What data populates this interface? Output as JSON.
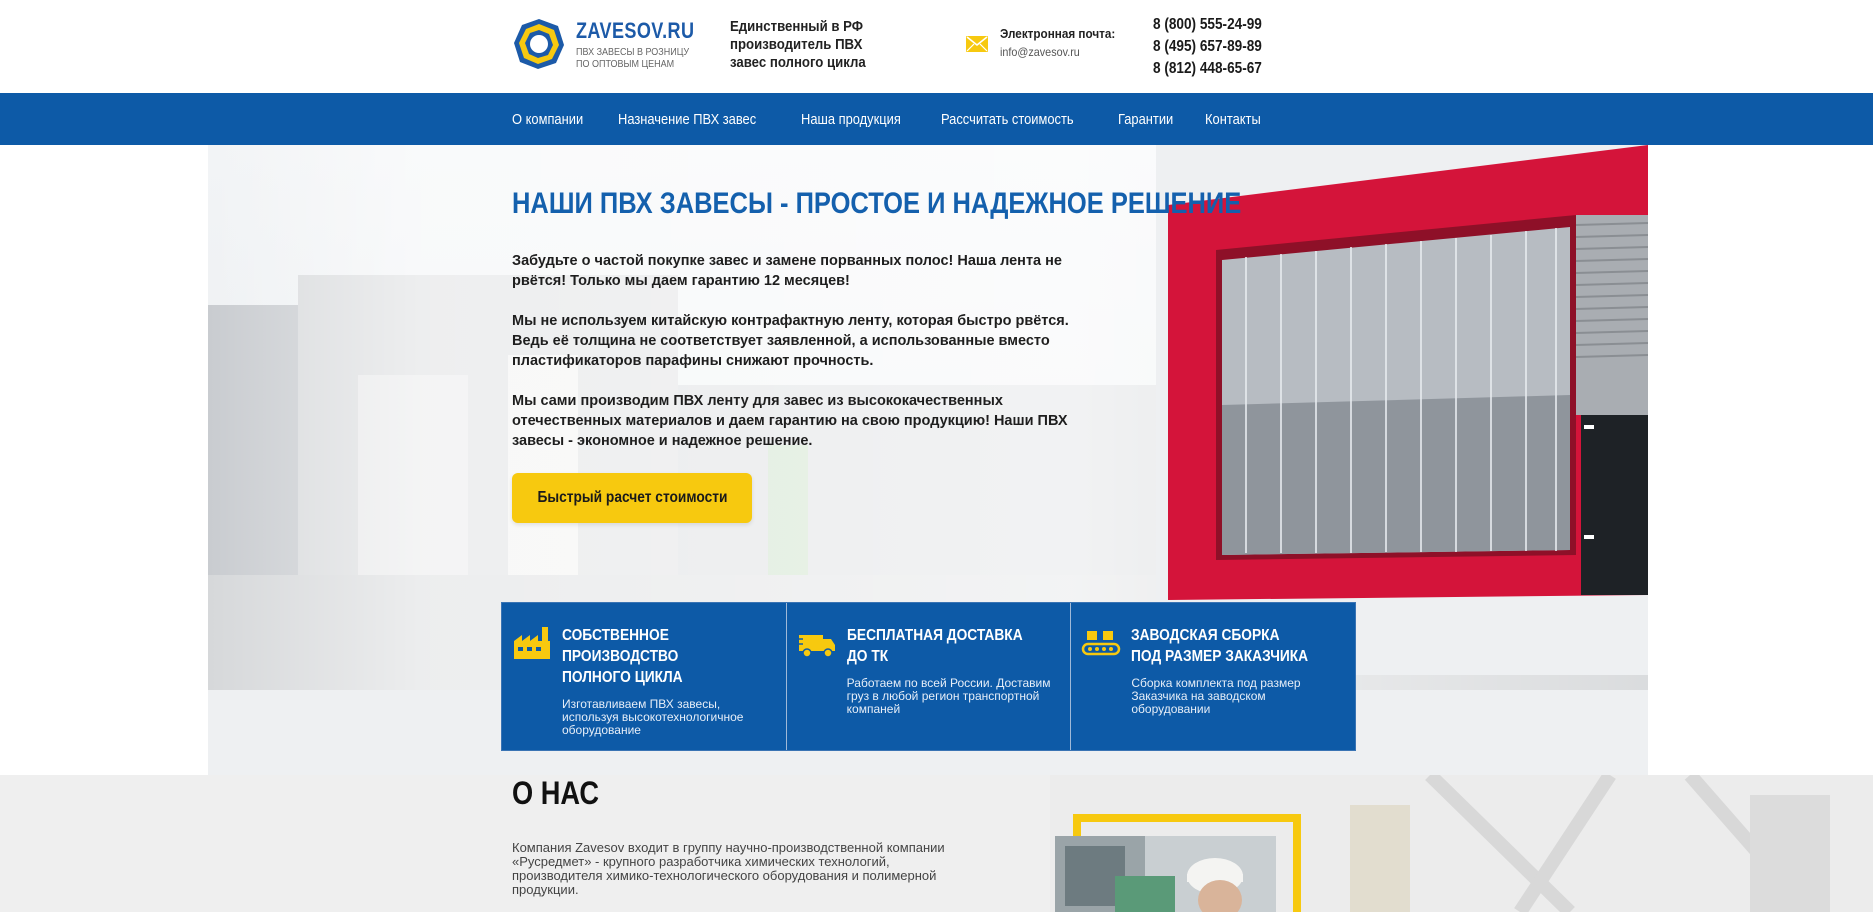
{
  "header": {
    "logo_name": "ZAVESOV.RU",
    "logo_tag_line1": "ПВХ ЗАВЕСЫ В РОЗНИЦУ",
    "logo_tag_line2": "ПО ОПТОВЫМ ЦЕНАМ",
    "slogan": "Единственный в РФ производитель ПВХ завес полного цикла",
    "email_label": "Электронная почта:",
    "email": "info@zavesov.ru",
    "phones": [
      "8 (800) 555-24-99",
      "8 (495) 657-89-89",
      "8 (812) 448-65-67"
    ]
  },
  "nav": {
    "items": [
      "О компании",
      "Назначение ПВХ завес",
      "Наша продукция",
      "Рассчитать стоимость",
      "Гарантии",
      "Контакты"
    ]
  },
  "hero": {
    "title": "НАШИ ПВХ ЗАВЕСЫ - ПРОСТОЕ И НАДЕЖНОЕ РЕШЕНИЕ",
    "p1": "Забудьте о частой покупке завес и замене порванных полос! Наша лента не рвётся! Только мы даем гарантию 12 месяцев!",
    "p2": "Мы не используем китайскую контрафактную ленту, которая быстро рвётся. Ведь её толщина не соответствует заявленной, а использованные вместо пластификаторов парафины снижают прочность.",
    "p3": "Мы сами производим ПВХ ленту для завес из высококачественных отечественных материалов и даем гарантию на свою продукцию! Наши ПВХ завесы - экономное и надежное решение.",
    "cta": "Быстрый расчет стоимости"
  },
  "features": [
    {
      "title": "Собственное производство полного цикла",
      "text": "Изготавливаем ПВХ завесы, используя высокотехнологичное оборудование",
      "icon": "factory-icon"
    },
    {
      "title": "Бесплатная доставка до ТК",
      "text": "Работаем по всей России. Доставим груз в любой регион транспортной компаней",
      "icon": "truck-icon"
    },
    {
      "title": "Заводская сборка под размер заказчика",
      "text": "Сборка комплекта под размер Заказчика на заводском оборудовании",
      "icon": "assembly-icon"
    }
  ],
  "about": {
    "title": "О НАС",
    "text": "Компания Zavesov входит в группу научно-производственной компании «Русредмет» - крупного разработчика химических технологий, производителя химико-технологического оборудования и полимерной продукции."
  },
  "colors": {
    "brand_blue": "#0d5aa7",
    "accent_yellow": "#f7c90f",
    "title_blue": "#1460ad"
  }
}
